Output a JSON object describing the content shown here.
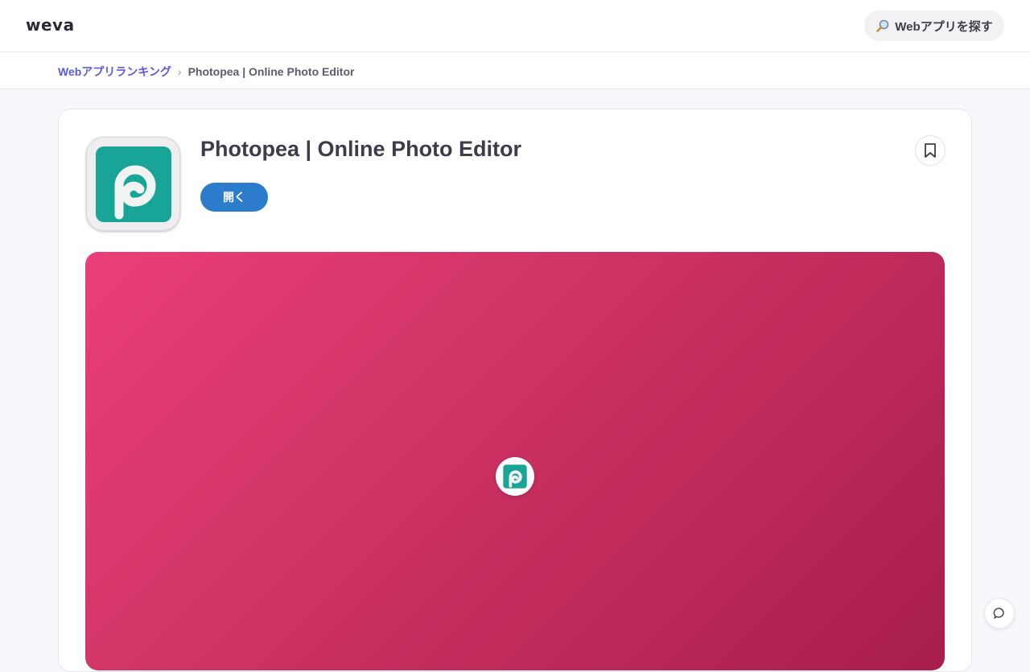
{
  "header": {
    "logo": "weva",
    "search_button_label": "Webアプリを探す",
    "search_icon": "magnifier-icon"
  },
  "breadcrumb": {
    "items": [
      {
        "label": "Webアプリランキング"
      },
      {
        "label": "Photopea | Online Photo Editor"
      }
    ],
    "separator": "›"
  },
  "app": {
    "title": "Photopea | Online Photo Editor",
    "open_label": "開く",
    "icon": "photopea-logo-icon",
    "bookmark_icon": "bookmark-icon"
  },
  "hero": {
    "badge_icon": "photopea-logo-icon"
  },
  "chat": {
    "icon": "chat-bubble-icon"
  },
  "colors": {
    "accent": "#2b7ccb",
    "link": "#5a5ae0",
    "hero_start": "#ea3f78",
    "hero_end": "#a81e4c",
    "photopea_green": "#18a497"
  }
}
